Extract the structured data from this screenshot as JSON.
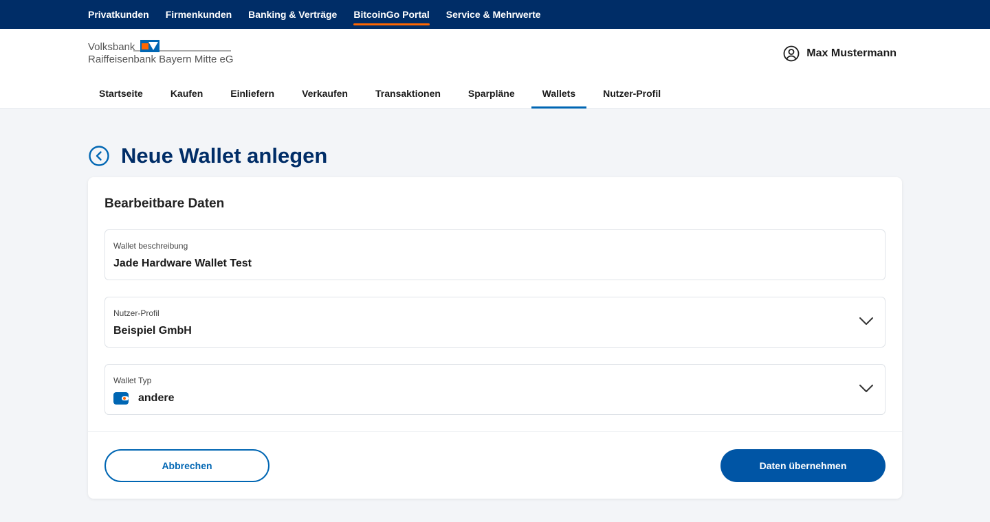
{
  "topbar": {
    "items": [
      {
        "label": "Privatkunden",
        "active": false
      },
      {
        "label": "Firmenkunden",
        "active": false
      },
      {
        "label": "Banking & Verträge",
        "active": false
      },
      {
        "label": "BitcoinGo Portal",
        "active": true
      },
      {
        "label": "Service & Mehrwerte",
        "active": false
      }
    ]
  },
  "header": {
    "logo_line1": "Volksbank",
    "logo_line2": "Raiffeisenbank Bayern Mitte eG",
    "user_name": "Max Mustermann"
  },
  "mainnav": {
    "tabs": [
      {
        "label": "Startseite"
      },
      {
        "label": "Kaufen"
      },
      {
        "label": "Einliefern"
      },
      {
        "label": "Verkaufen"
      },
      {
        "label": "Transaktionen"
      },
      {
        "label": "Sparpläne"
      },
      {
        "label": "Wallets",
        "active": true
      },
      {
        "label": "Nutzer-Profil"
      }
    ]
  },
  "page": {
    "title": "Neue Wallet anlegen"
  },
  "form": {
    "title": "Bearbeitbare Daten",
    "description": {
      "label": "Wallet beschreibung",
      "value": "Jade Hardware Wallet Test"
    },
    "profile": {
      "label": "Nutzer-Profil",
      "value": "Beispiel GmbH"
    },
    "wallet_type": {
      "label": "Wallet Typ",
      "value": "andere"
    }
  },
  "actions": {
    "cancel_label": "Abbrechen",
    "submit_label": "Daten übernehmen"
  },
  "colors": {
    "brand_dark": "#002d67",
    "brand_blue": "#0066b3",
    "accent_orange": "#ff6600"
  }
}
